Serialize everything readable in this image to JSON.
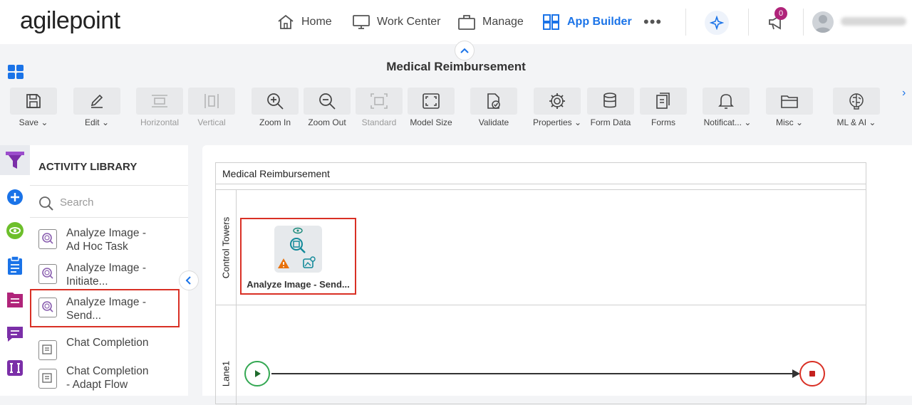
{
  "brand": {
    "logo_text": "agilepoint"
  },
  "nav": {
    "items": [
      {
        "label": "Home",
        "icon": "home-icon"
      },
      {
        "label": "Work Center",
        "icon": "monitor-icon"
      },
      {
        "label": "Manage",
        "icon": "briefcase-icon"
      },
      {
        "label": "App Builder",
        "icon": "grid-icon",
        "active": true
      }
    ],
    "more_label": "•••",
    "notifications_count": "0"
  },
  "page": {
    "title": "Medical Reimbursement"
  },
  "toolbar": {
    "items": [
      {
        "label": "Save",
        "icon": "save-icon",
        "dropdown": true
      },
      {
        "label": "Edit",
        "icon": "pencil-icon",
        "dropdown": true
      },
      {
        "label": "Horizontal",
        "icon": "horizontal-layout-icon",
        "disabled": true
      },
      {
        "label": "Vertical",
        "icon": "vertical-layout-icon",
        "disabled": true
      },
      {
        "label": "Zoom In",
        "icon": "zoom-in-icon"
      },
      {
        "label": "Zoom Out",
        "icon": "zoom-out-icon"
      },
      {
        "label": "Standard",
        "icon": "standard-size-icon",
        "disabled": true
      },
      {
        "label": "Model Size",
        "icon": "fit-size-icon"
      },
      {
        "label": "Validate",
        "icon": "validate-icon"
      },
      {
        "label": "Properties",
        "icon": "gear-icon",
        "dropdown": true
      },
      {
        "label": "Form Data",
        "icon": "database-icon"
      },
      {
        "label": "Forms",
        "icon": "forms-icon"
      },
      {
        "label": "Notificat...",
        "icon": "bell-icon",
        "dropdown": true
      },
      {
        "label": "Misc",
        "icon": "folder-icon",
        "dropdown": true
      },
      {
        "label": "ML & AI",
        "icon": "brain-icon",
        "dropdown": true
      }
    ]
  },
  "library": {
    "title": "ACTIVITY LIBRARY",
    "search_placeholder": "Search",
    "items": [
      {
        "line1": "Analyze Image -",
        "line2": "Ad Hoc Task"
      },
      {
        "line1": "Analyze Image -",
        "line2": "Initiate..."
      },
      {
        "line1": "Analyze Image -",
        "line2": "Send...",
        "selected": true
      },
      {
        "line1": "Chat Completion",
        "line2": ""
      },
      {
        "line1": "Chat Completion",
        "line2": "- Adapt Flow"
      }
    ]
  },
  "canvas": {
    "pool_title": "Medical Reimbursement",
    "lanes": [
      {
        "label": "Control Towers"
      },
      {
        "label": "Lane1"
      }
    ],
    "activity": {
      "label": "Analyze Image - Send..."
    }
  },
  "colors": {
    "accent": "#1a73e8",
    "selection": "#d93025",
    "start": "#34a853",
    "end": "#d93025",
    "badge": "#b0247a"
  }
}
